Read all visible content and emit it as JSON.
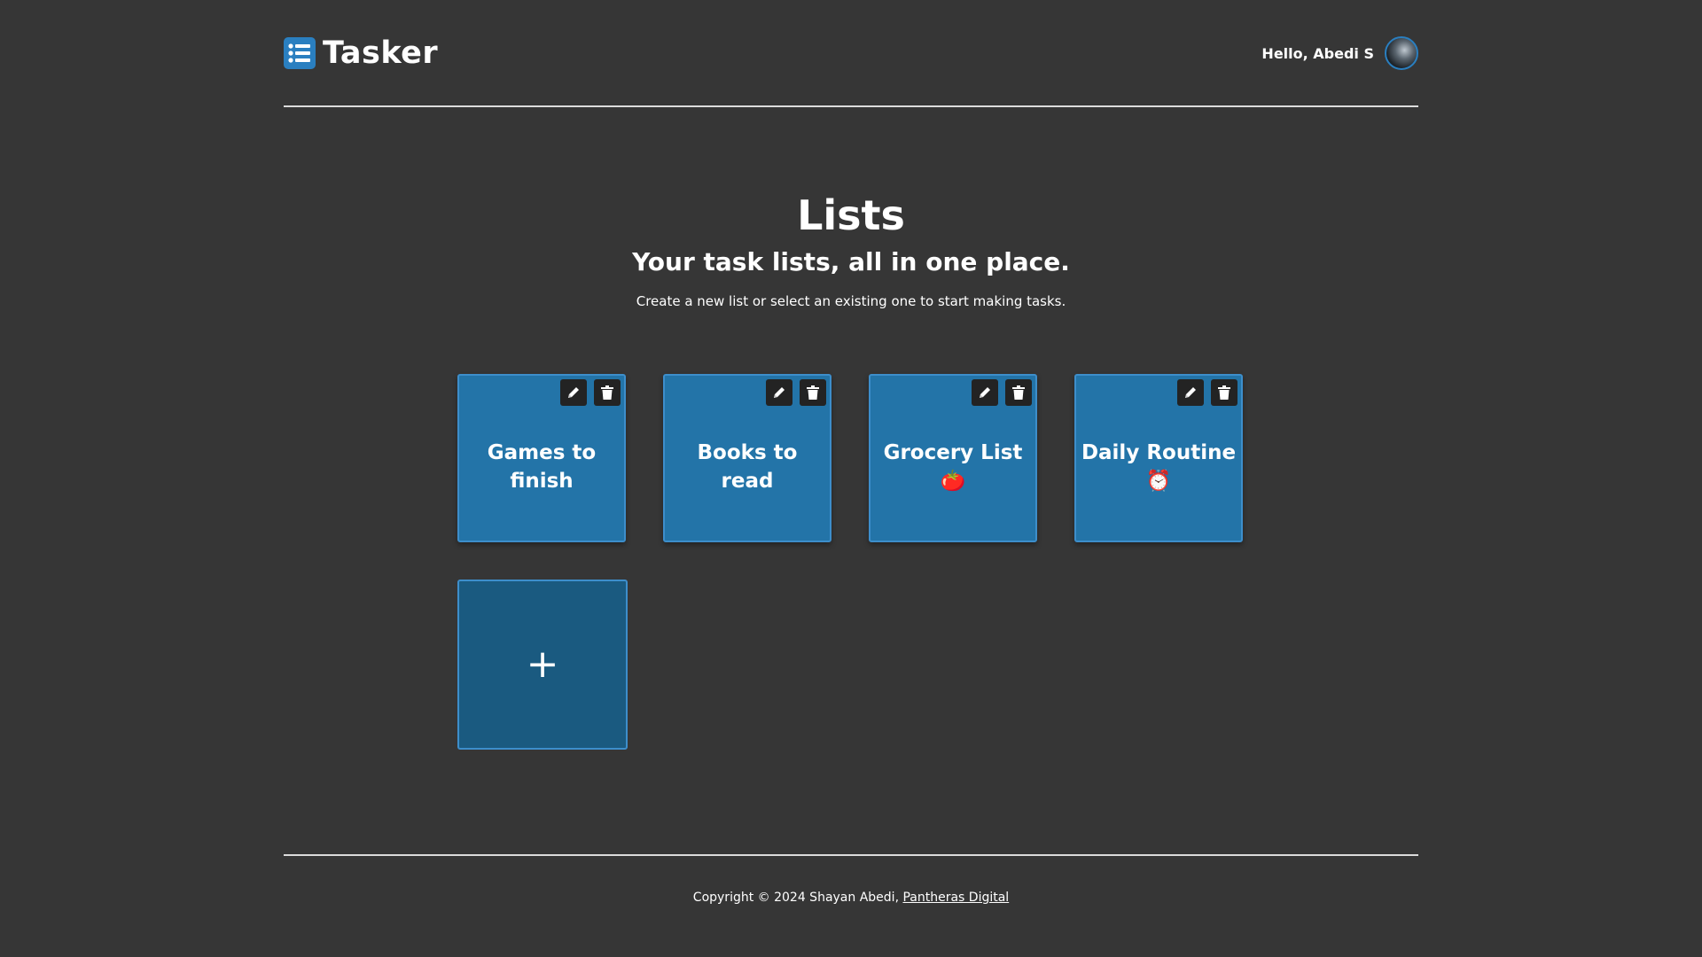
{
  "header": {
    "brand_icon": "list-icon",
    "brand_name": "Tasker",
    "greeting": "Hello, Abedi S",
    "avatar_icon": "user-avatar"
  },
  "hero": {
    "title": "Lists",
    "subtitle": "Your task lists, all in one place.",
    "description": "Create a new list or select an existing one to start making tasks."
  },
  "lists": [
    {
      "title": "Games to finish",
      "emoji": ""
    },
    {
      "title": "Books to read",
      "emoji": ""
    },
    {
      "title": "Grocery List",
      "emoji": "🍅"
    },
    {
      "title": "Daily Routine",
      "emoji": "⏰"
    }
  ],
  "card_actions": {
    "edit_icon": "pencil-icon",
    "delete_icon": "trash-icon"
  },
  "add_card": {
    "label": "+"
  },
  "footer": {
    "copyright": "Copyright © 2024 Shayan Abedi, ",
    "link_text": "Pantheras Digital"
  },
  "colors": {
    "background": "#363636",
    "accent": "#2374a8",
    "add_card": "#1a5a80",
    "brand_icon": "#2a7fc0"
  }
}
